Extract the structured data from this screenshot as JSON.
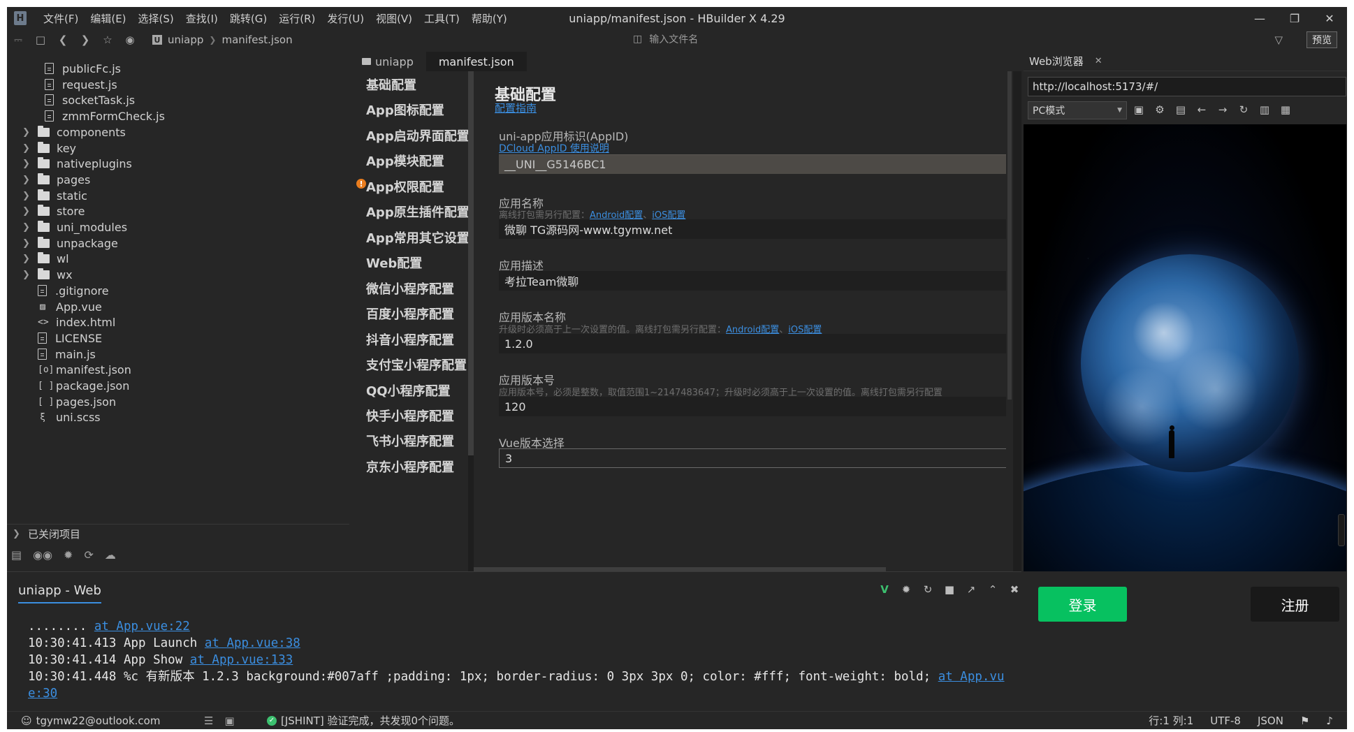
{
  "window": {
    "logo": "H",
    "title": "uniapp/manifest.json - HBuilder X 4.29",
    "menu": [
      "文件(F)",
      "编辑(E)",
      "选择(S)",
      "查找(I)",
      "跳转(G)",
      "运行(R)",
      "发行(U)",
      "视图(V)",
      "工具(T)",
      "帮助(Y)"
    ]
  },
  "toolbar": {
    "breadcrumb": [
      "uniapp",
      "manifest.json"
    ],
    "project_icon": "U",
    "file_search_placeholder": "输入文件名",
    "preview_label": "预览"
  },
  "tree": {
    "items": [
      {
        "label": "publicFc.js",
        "kind": "file"
      },
      {
        "label": "request.js",
        "kind": "file"
      },
      {
        "label": "socketTask.js",
        "kind": "file"
      },
      {
        "label": "zmmFormCheck.js",
        "kind": "file"
      },
      {
        "label": "components",
        "kind": "folder"
      },
      {
        "label": "key",
        "kind": "folder"
      },
      {
        "label": "nativeplugins",
        "kind": "folder"
      },
      {
        "label": "pages",
        "kind": "folder"
      },
      {
        "label": "static",
        "kind": "folder"
      },
      {
        "label": "store",
        "kind": "folder"
      },
      {
        "label": "uni_modules",
        "kind": "folder"
      },
      {
        "label": "unpackage",
        "kind": "folder"
      },
      {
        "label": "wl",
        "kind": "folder"
      },
      {
        "label": "wx",
        "kind": "folder"
      },
      {
        "label": ".gitignore",
        "kind": "plain"
      },
      {
        "label": "App.vue",
        "kind": "vue"
      },
      {
        "label": "index.html",
        "kind": "html"
      },
      {
        "label": "LICENSE",
        "kind": "plain"
      },
      {
        "label": "main.js",
        "kind": "file"
      },
      {
        "label": "manifest.json",
        "kind": "manifest"
      },
      {
        "label": "package.json",
        "kind": "json"
      },
      {
        "label": "pages.json",
        "kind": "json"
      },
      {
        "label": "uni.scss",
        "kind": "scss"
      }
    ],
    "closed_projects": "已关闭项目"
  },
  "editor": {
    "tabs": [
      "uniapp",
      "manifest.json"
    ]
  },
  "manifest": {
    "nav": [
      "基础配置",
      "App图标配置",
      "App启动界面配置",
      "App模块配置",
      "App权限配置",
      "App原生插件配置",
      "App常用其它设置",
      "Web配置",
      "微信小程序配置",
      "百度小程序配置",
      "抖音小程序配置",
      "支付宝小程序配置",
      "QQ小程序配置",
      "快手小程序配置",
      "飞书小程序配置",
      "京东小程序配置"
    ],
    "title": "基础配置",
    "guide_link": "配置指南",
    "appid_label": "uni-app应用标识(AppID)",
    "appid_link": "DCloud AppID 使用说明",
    "appid_value": "__UNI__G5146BC1",
    "name_label": "应用名称",
    "name_hint": "离线打包需另行配置：",
    "android_link": "Android配置",
    "sep": "、",
    "ios_link": "iOS配置",
    "name_value": "微聊 TG源码网-www.tgymw.net",
    "desc_label": "应用描述",
    "desc_value": "考拉Team微聊",
    "vname_label": "应用版本名称",
    "vname_hint": "升级时必须高于上一次设置的值。离线打包需另行配置：",
    "vname_value": "1.2.0",
    "vcode_label": "应用版本号",
    "vcode_hint": "应用版本号，必须是整数，取值范围1~2147483647；升级时必须高于上一次设置的值。离线打包需另行配置",
    "vcode_value": "120",
    "vue_label": "Vue版本选择",
    "vue_value": "3"
  },
  "webpanel": {
    "tab": "Web浏览器",
    "url": "http://localhost:5173/#/",
    "mode": "PC模式",
    "login": "登录",
    "register": "注册"
  },
  "console": {
    "tab": "uniapp - Web",
    "lines": [
      {
        "text": "........ ",
        "link": "at App.vue:22"
      },
      {
        "text": "10:30:41.413 App Launch ",
        "link": "at App.vue:38"
      },
      {
        "text": "10:30:41.414 App Show ",
        "link": "at App.vue:133"
      },
      {
        "text": "10:30:41.448 %c 有新版本 1.2.3 background:#007aff ;padding: 1px; border-radius: 0 3px 3px 0;  color: #fff; font-weight: bold; ",
        "link": "at App.vue:30"
      }
    ]
  },
  "status": {
    "account": "tgymw22@outlook.com",
    "message": "[JSHINT] 验证完成，共发现0个问题。",
    "position": "行:1  列:1",
    "encoding": "UTF-8",
    "language": "JSON"
  },
  "colors": {
    "accent": "#3b8ee0",
    "login_green": "#07c160",
    "warning": "#e97d1f"
  }
}
